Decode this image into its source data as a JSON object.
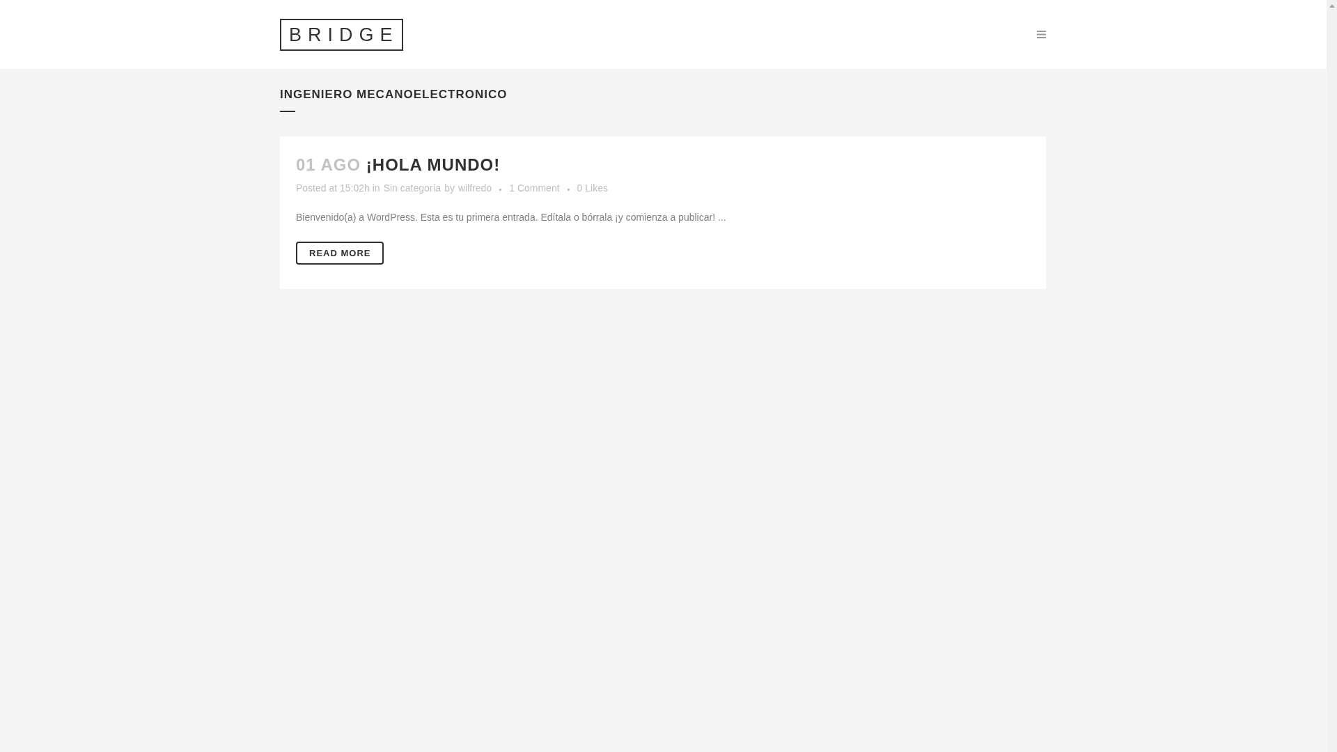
{
  "header": {
    "logo": "BRIDGE"
  },
  "page_title": "INGENIERO MECANOELECTRONICO",
  "posts": [
    {
      "date": "01 AGO",
      "title": "¡HOLA MUNDO!",
      "posted": "Posted at 15:02h in",
      "category": "Sin categoría",
      "by": "by",
      "author": "wilfredo",
      "comments": "1 Comment",
      "likes_count": "0",
      "likes_label": "Likes",
      "excerpt": "Bienvenido(a) a WordPress. Esta es tu primera entrada. Edítala o bórrala ¡y comienza a publicar! ...",
      "button": "READ MORE"
    }
  ]
}
